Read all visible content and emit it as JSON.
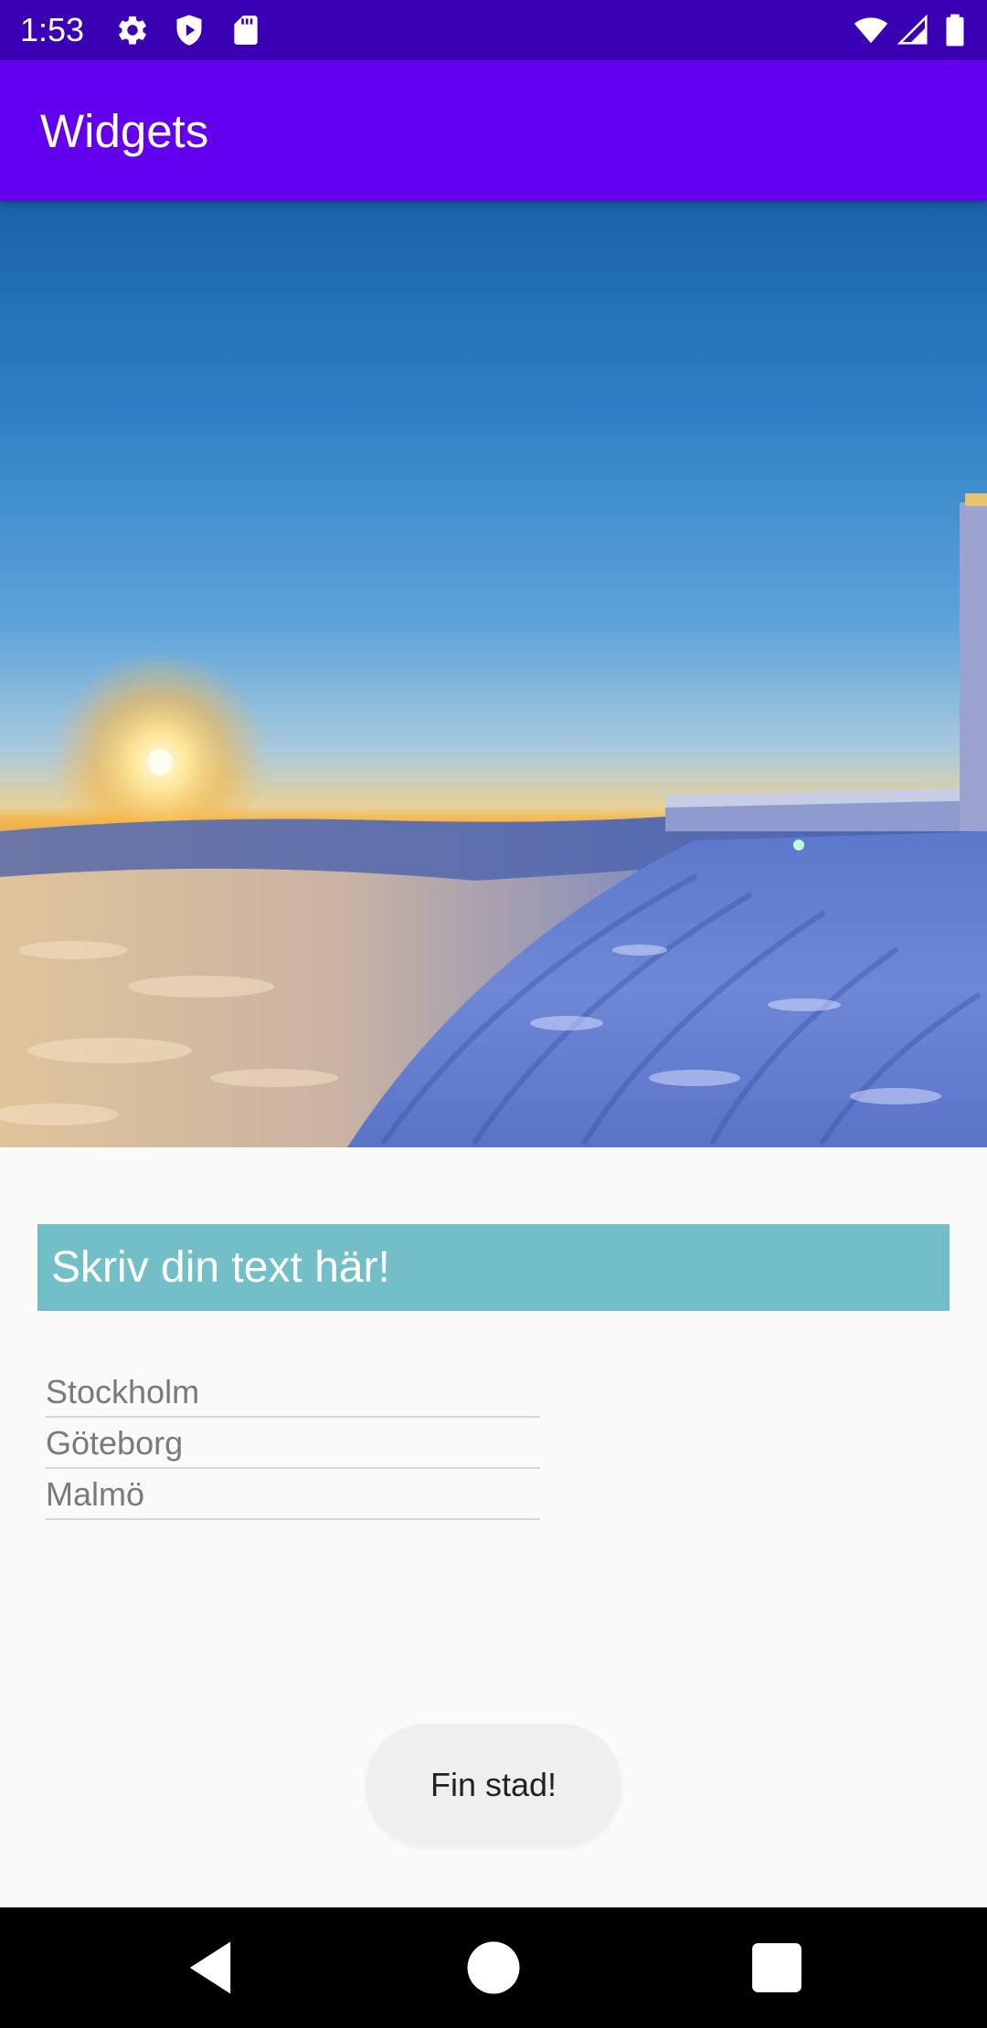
{
  "status_bar": {
    "time": "1:53",
    "background_color": "#3a00b4",
    "icons_left": [
      "gear-icon",
      "shield-play-icon",
      "sd-card-icon"
    ],
    "icons_right": [
      "wifi-icon",
      "cellular-signal-icon",
      "battery-icon"
    ]
  },
  "app_bar": {
    "title": "Widgets",
    "background_color": "#6200ee"
  },
  "hero_image": {
    "subject": "sunset-over-snowy-mountain"
  },
  "text_banner": {
    "text": "Skriv din text här!",
    "background_color": "#73bfc8"
  },
  "city_list": {
    "items": [
      "Stockholm",
      "Göteborg",
      "Malmö"
    ]
  },
  "toast": {
    "text": "Fin stad!"
  },
  "nav_bar": {
    "buttons": [
      "back-icon",
      "home-icon",
      "recents-icon"
    ]
  }
}
